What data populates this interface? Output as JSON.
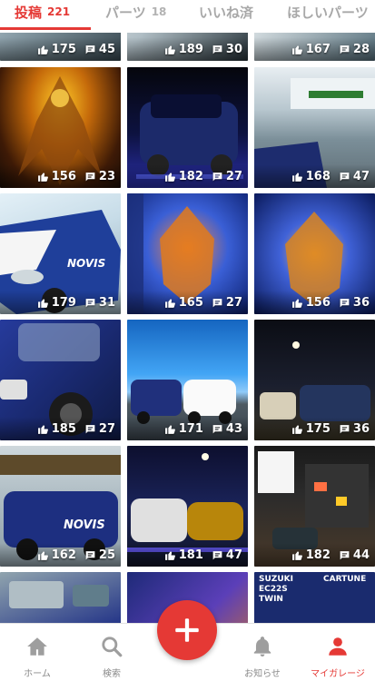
{
  "tabs": [
    {
      "label": "投稿",
      "count": "221",
      "active": true
    },
    {
      "label": "パーツ",
      "count": "18",
      "active": false
    },
    {
      "label": "いいね済",
      "count": "",
      "active": false
    },
    {
      "label": "ほしいパーツ",
      "count": "",
      "active": false
    }
  ],
  "posts": [
    {
      "likes": "175",
      "comments": "45"
    },
    {
      "likes": "189",
      "comments": "30"
    },
    {
      "likes": "167",
      "comments": "28"
    },
    {
      "likes": "156",
      "comments": "23"
    },
    {
      "likes": "182",
      "comments": "27"
    },
    {
      "likes": "168",
      "comments": "47"
    },
    {
      "likes": "179",
      "comments": "31"
    },
    {
      "likes": "165",
      "comments": "27"
    },
    {
      "likes": "156",
      "comments": "36"
    },
    {
      "likes": "185",
      "comments": "27"
    },
    {
      "likes": "171",
      "comments": "43"
    },
    {
      "likes": "175",
      "comments": "36"
    },
    {
      "likes": "162",
      "comments": "25"
    },
    {
      "likes": "181",
      "comments": "47"
    },
    {
      "likes": "182",
      "comments": "44"
    },
    {
      "likes": "",
      "comments": ""
    },
    {
      "likes": "",
      "comments": ""
    },
    {
      "likes": "",
      "comments": ""
    }
  ],
  "photo_text": {
    "novis": "NOVIS",
    "suzuki_label": "SUZUKI EC22S TWIN",
    "cartune_label": "CARTUNE"
  },
  "nav": [
    {
      "label": "ホーム",
      "icon": "home-icon",
      "active": false
    },
    {
      "label": "検索",
      "icon": "search-icon",
      "active": false
    },
    {
      "label": "お知らせ",
      "icon": "bell-icon",
      "active": false
    },
    {
      "label": "マイガレージ",
      "icon": "person-icon",
      "active": true
    }
  ],
  "fab_icon": "plus-icon",
  "colors": {
    "accent": "#e53935",
    "inactive": "#9e9e9e"
  }
}
